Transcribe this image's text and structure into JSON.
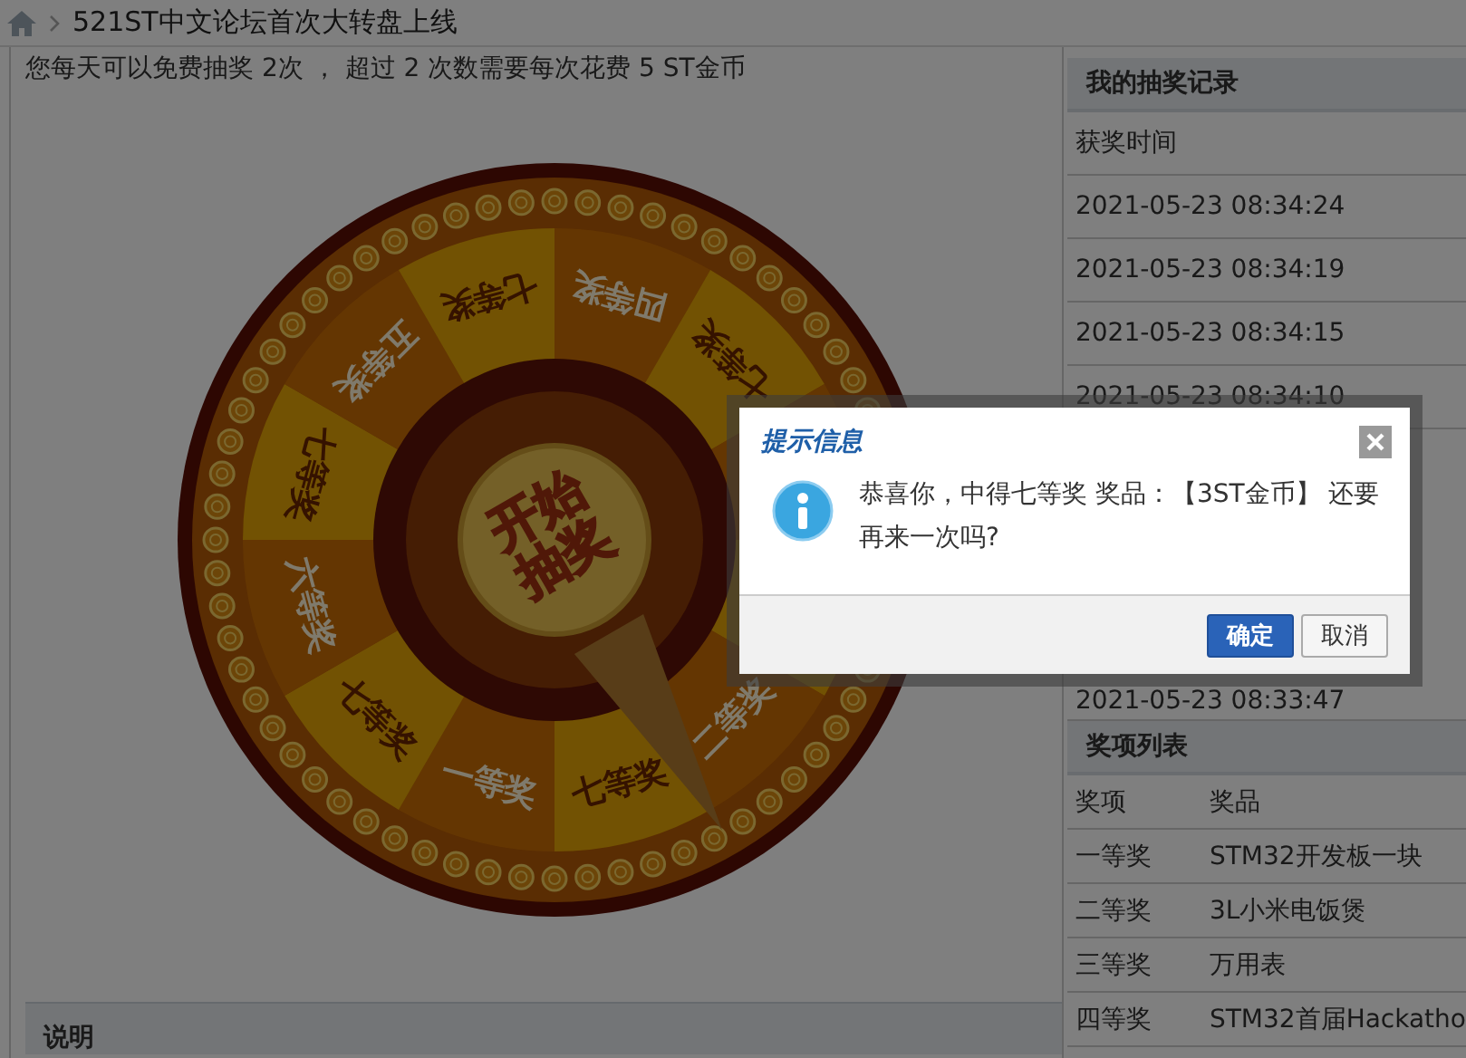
{
  "breadcrumb": {
    "title": "521ST中文论坛首次大转盘上线"
  },
  "notice": "您每天可以免费抽奖 2次 ， 超过 2 次数需要每次花费 5 ST金币",
  "wheel": {
    "start_label": [
      "开始",
      "抽奖"
    ],
    "segments": [
      {
        "kind": "prize",
        "label": "四等奖"
      },
      {
        "kind": "prize",
        "label": "七等奖"
      },
      {
        "kind": "covered"
      },
      {
        "kind": "covered"
      },
      {
        "kind": "prize",
        "label": "二等奖"
      },
      {
        "kind": "prize",
        "label": "七等奖"
      },
      {
        "kind": "prize",
        "label": "一等奖"
      },
      {
        "kind": "prize",
        "label": "七等奖"
      },
      {
        "kind": "prize",
        "label": "六等奖"
      },
      {
        "kind": "prize",
        "label": "七等奖"
      },
      {
        "kind": "prize",
        "label": "五等奖"
      },
      {
        "kind": "prize",
        "label": "七等奖"
      }
    ]
  },
  "notes": {
    "title": "说明"
  },
  "records": {
    "title": "我的抽奖记录",
    "column": "获奖时间",
    "rows": [
      "2021-05-23 08:34:24",
      "2021-05-23 08:34:19",
      "2021-05-23 08:34:15",
      "2021-05-23 08:34:10",
      "2021-05-23 08:33:47"
    ]
  },
  "prizes": {
    "title": "奖项列表",
    "columns": [
      "奖项",
      "奖品"
    ],
    "rows": [
      {
        "level": "一等奖",
        "prize": "STM32开发板一块"
      },
      {
        "level": "二等奖",
        "prize": "3L小米电饭煲"
      },
      {
        "level": "三等奖",
        "prize": "万用表"
      },
      {
        "level": "四等奖",
        "prize": "STM32首届Hackatho"
      }
    ]
  },
  "dialog": {
    "title": "提示信息",
    "message": "恭喜你，中得七等奖 奖品：【3ST金币】 还要再来一次吗?",
    "buttons": [
      {
        "label": "确定",
        "kind": "primary"
      },
      {
        "label": "取消",
        "kind": "default"
      }
    ]
  }
}
